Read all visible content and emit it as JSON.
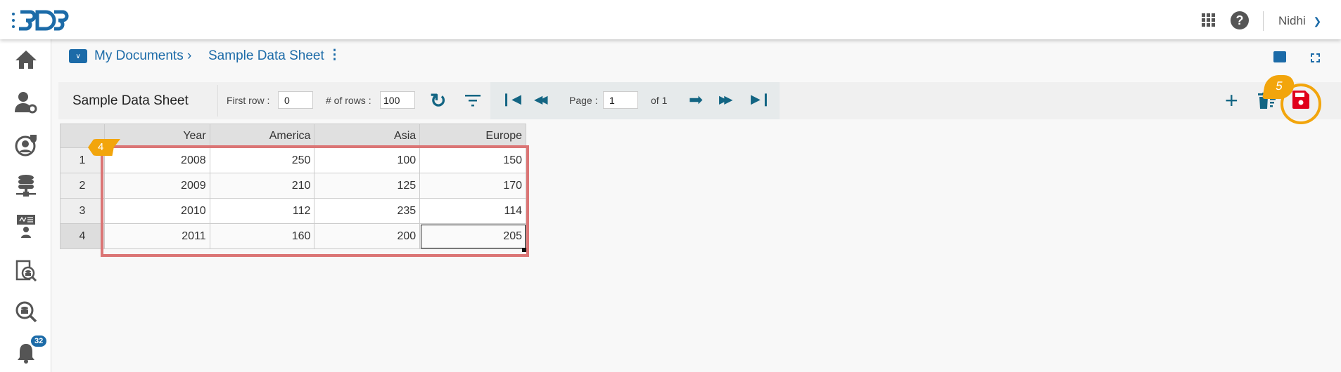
{
  "header": {
    "logo": "BDB",
    "user": "Nidhi"
  },
  "sidebar": {
    "notification_count": "32"
  },
  "breadcrumb": {
    "root": "My Documents",
    "current": "Sample Data Sheet"
  },
  "toolbar": {
    "title": "Sample Data Sheet",
    "first_row_label": "First row :",
    "first_row_value": "0",
    "rows_label": "# of rows :",
    "rows_value": "100",
    "page_label": "Page :",
    "page_value": "1",
    "page_of": "of 1"
  },
  "table": {
    "columns": [
      "Year",
      "America",
      "Asia",
      "Europe"
    ],
    "rows": [
      [
        "1",
        "2008",
        "250",
        "100",
        "150"
      ],
      [
        "2",
        "2009",
        "210",
        "125",
        "170"
      ],
      [
        "3",
        "2010",
        "112",
        "235",
        "114"
      ],
      [
        "4",
        "2011",
        "160",
        "200",
        "205"
      ]
    ]
  },
  "annotations": {
    "step4": "4",
    "step5": "5"
  },
  "colors": {
    "accent": "#1c6ba8",
    "toolbar_icon": "#136583",
    "save": "#e0001b",
    "callout": "#f2a50c",
    "highlight": "#db7575"
  }
}
